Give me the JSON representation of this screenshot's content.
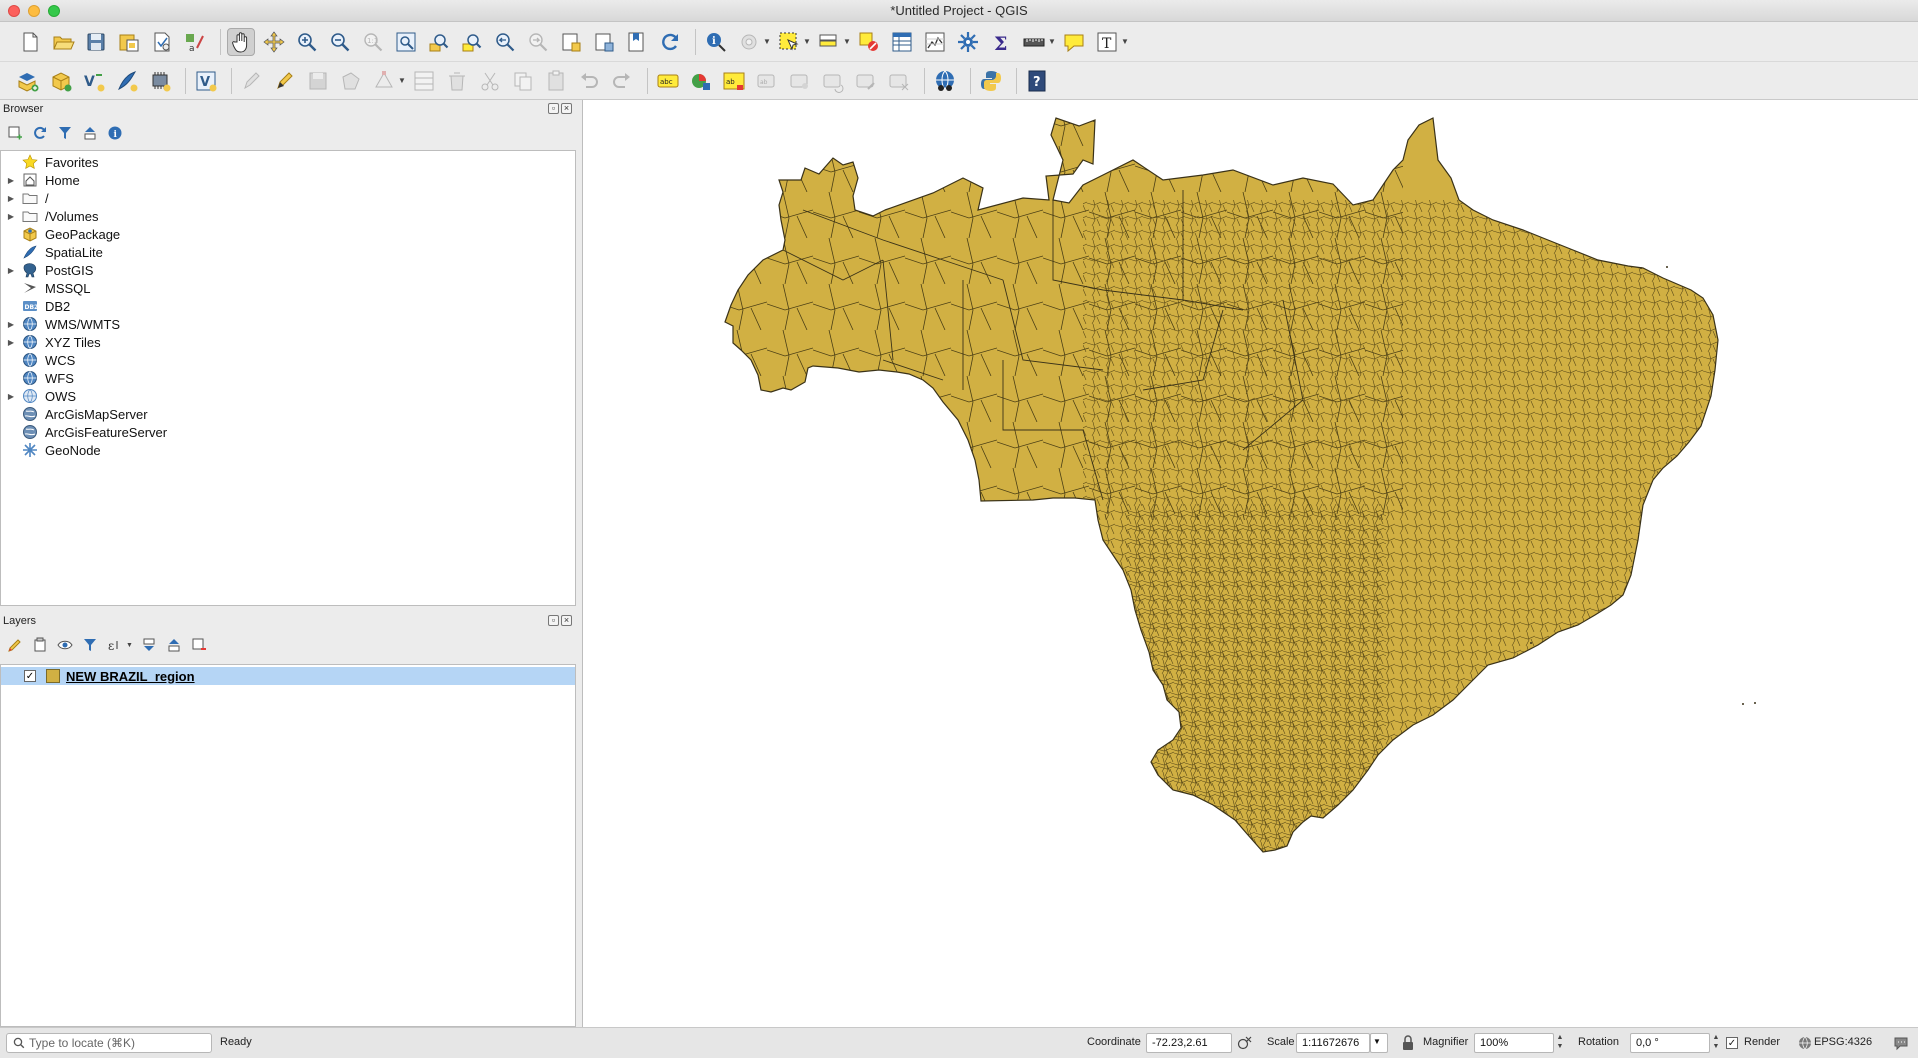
{
  "window": {
    "title": "*Untitled Project - QGIS"
  },
  "toolbar1": {
    "buttons": [
      "new-project",
      "open-project",
      "save-project",
      "save-as",
      "print-layout",
      "style-manager",
      "pan-map",
      "pan-to-selection",
      "zoom-in",
      "zoom-out",
      "zoom-native",
      "zoom-full",
      "zoom-layer",
      "zoom-selection",
      "zoom-last",
      "zoom-next",
      "new-bookmark",
      "show-bookmarks",
      "map-tips-hide",
      "refresh",
      "identify",
      "action",
      "select",
      "select-dd",
      "open-attribute",
      "deselect",
      "attribute-table",
      "statistics",
      "processing",
      "sum",
      "measure",
      "annotation",
      "text-annotation"
    ]
  },
  "browser": {
    "title": "Browser",
    "items": [
      {
        "label": "Favorites",
        "icon": "star-icon",
        "expand": false
      },
      {
        "label": "Home",
        "icon": "home-icon",
        "expand": true
      },
      {
        "label": "/",
        "icon": "folder-icon",
        "expand": true
      },
      {
        "label": "/Volumes",
        "icon": "folder-icon",
        "expand": true
      },
      {
        "label": "GeoPackage",
        "icon": "geopackage-icon",
        "expand": false
      },
      {
        "label": "SpatiaLite",
        "icon": "feather-icon",
        "expand": false
      },
      {
        "label": "PostGIS",
        "icon": "elephant-icon",
        "expand": true
      },
      {
        "label": "MSSQL",
        "icon": "mssql-icon",
        "expand": false
      },
      {
        "label": "DB2",
        "icon": "db2-icon",
        "expand": false
      },
      {
        "label": "WMS/WMTS",
        "icon": "globe-icon",
        "expand": true
      },
      {
        "label": "XYZ Tiles",
        "icon": "globe-icon",
        "expand": true
      },
      {
        "label": "WCS",
        "icon": "globe-icon",
        "expand": false
      },
      {
        "label": "WFS",
        "icon": "globe-icon",
        "expand": false
      },
      {
        "label": "OWS",
        "icon": "globe-outline-icon",
        "expand": true
      },
      {
        "label": "ArcGisMapServer",
        "icon": "arcgis-icon",
        "expand": false
      },
      {
        "label": "ArcGisFeatureServer",
        "icon": "arcgis-icon",
        "expand": false
      },
      {
        "label": "GeoNode",
        "icon": "geonode-icon",
        "expand": false
      }
    ]
  },
  "layers": {
    "title": "Layers",
    "items": [
      {
        "label": "NEW BRAZIL_region",
        "checked": true,
        "fill": "#d1b043"
      }
    ]
  },
  "map": {
    "fill": "#d1b043",
    "stroke": "#3a3218"
  },
  "status": {
    "locator_placeholder": "Type to locate (⌘K)",
    "message": "Ready",
    "coordinate_label": "Coordinate",
    "coordinate_value": "-72.23,2.61",
    "scale_label": "Scale",
    "scale_value": "1:11672676",
    "magnifier_label": "Magnifier",
    "magnifier_value": "100%",
    "rotation_label": "Rotation",
    "rotation_value": "0,0 °",
    "render_label": "Render",
    "crs": "EPSG:4326"
  }
}
